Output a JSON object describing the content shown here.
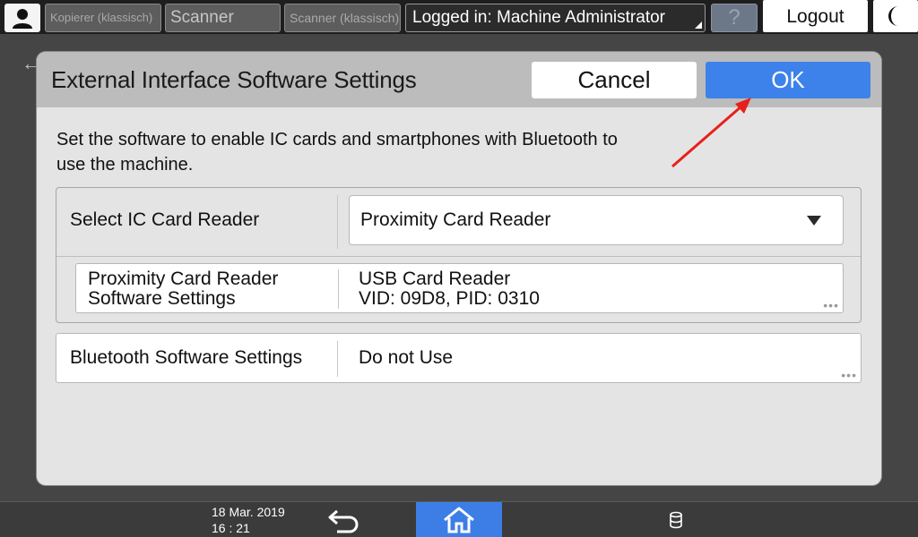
{
  "topbar": {
    "user_icon": "user-icon",
    "apps": [
      {
        "label": "Kopierer (klassisch)"
      },
      {
        "label": "Scanner"
      },
      {
        "label": "Scanner (klassisch)"
      }
    ],
    "login_status": "Logged in: Machine Administrator",
    "help_label": "?",
    "logout_label": "Logout",
    "sleep_icon": "moon-icon"
  },
  "dialog": {
    "title": "External Interface Software Settings",
    "cancel_label": "Cancel",
    "ok_label": "OK",
    "description": "Set the software to enable IC cards and smartphones with Bluetooth to use the machine.",
    "ic_card": {
      "label": "Select IC Card Reader",
      "selected": "Proximity Card Reader",
      "sub_setting": {
        "label": "Proximity Card Reader Software Settings",
        "value_line1": "USB Card Reader",
        "value_line2": "VID: 09D8, PID: 0310"
      }
    },
    "bluetooth": {
      "label": "Bluetooth Software Settings",
      "value": "Do not Use"
    }
  },
  "bottombar": {
    "date": "18 Mar. 2019",
    "time": "16 : 21",
    "back_icon": "back-arrow-icon",
    "home_icon": "home-icon",
    "storage_icon": "storage-icon"
  },
  "colors": {
    "accent": "#3d82ea",
    "annotation": "#e8201c"
  }
}
